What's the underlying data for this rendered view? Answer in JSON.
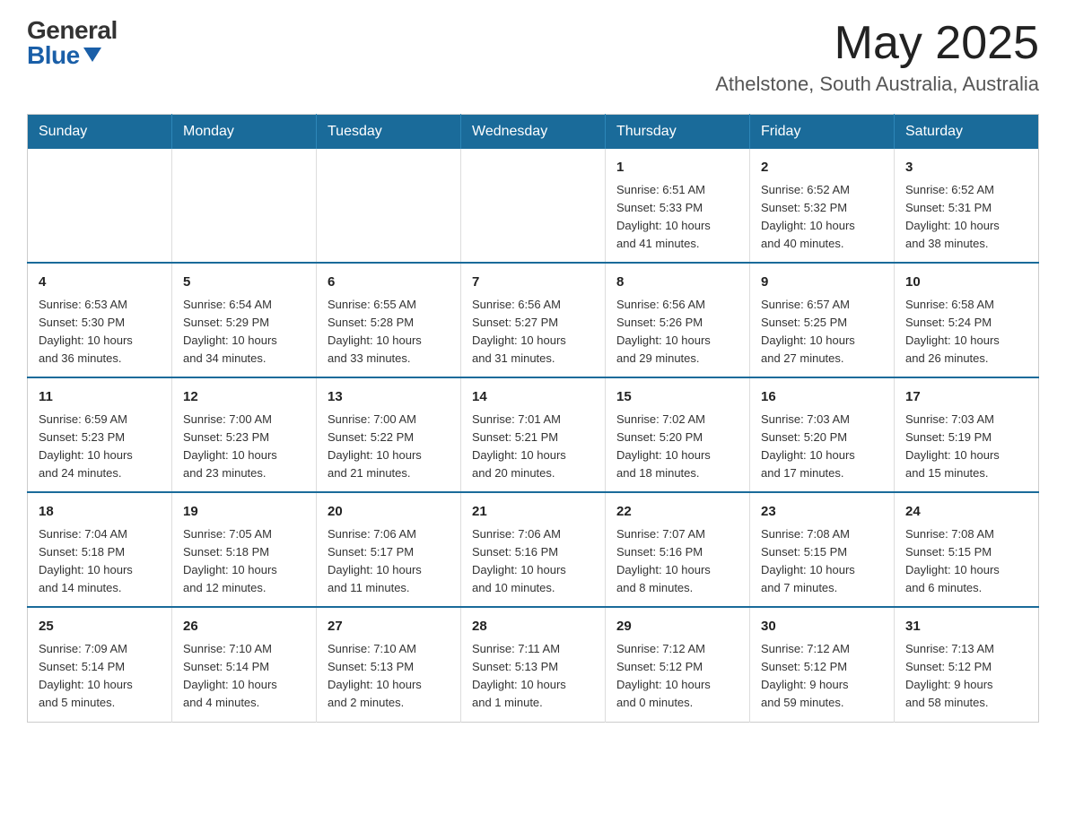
{
  "header": {
    "logo_general": "General",
    "logo_blue": "Blue",
    "month_title": "May 2025",
    "location": "Athelstone, South Australia, Australia"
  },
  "calendar": {
    "days_of_week": [
      "Sunday",
      "Monday",
      "Tuesday",
      "Wednesday",
      "Thursday",
      "Friday",
      "Saturday"
    ],
    "weeks": [
      [
        {
          "day": "",
          "info": ""
        },
        {
          "day": "",
          "info": ""
        },
        {
          "day": "",
          "info": ""
        },
        {
          "day": "",
          "info": ""
        },
        {
          "day": "1",
          "info": "Sunrise: 6:51 AM\nSunset: 5:33 PM\nDaylight: 10 hours\nand 41 minutes."
        },
        {
          "day": "2",
          "info": "Sunrise: 6:52 AM\nSunset: 5:32 PM\nDaylight: 10 hours\nand 40 minutes."
        },
        {
          "day": "3",
          "info": "Sunrise: 6:52 AM\nSunset: 5:31 PM\nDaylight: 10 hours\nand 38 minutes."
        }
      ],
      [
        {
          "day": "4",
          "info": "Sunrise: 6:53 AM\nSunset: 5:30 PM\nDaylight: 10 hours\nand 36 minutes."
        },
        {
          "day": "5",
          "info": "Sunrise: 6:54 AM\nSunset: 5:29 PM\nDaylight: 10 hours\nand 34 minutes."
        },
        {
          "day": "6",
          "info": "Sunrise: 6:55 AM\nSunset: 5:28 PM\nDaylight: 10 hours\nand 33 minutes."
        },
        {
          "day": "7",
          "info": "Sunrise: 6:56 AM\nSunset: 5:27 PM\nDaylight: 10 hours\nand 31 minutes."
        },
        {
          "day": "8",
          "info": "Sunrise: 6:56 AM\nSunset: 5:26 PM\nDaylight: 10 hours\nand 29 minutes."
        },
        {
          "day": "9",
          "info": "Sunrise: 6:57 AM\nSunset: 5:25 PM\nDaylight: 10 hours\nand 27 minutes."
        },
        {
          "day": "10",
          "info": "Sunrise: 6:58 AM\nSunset: 5:24 PM\nDaylight: 10 hours\nand 26 minutes."
        }
      ],
      [
        {
          "day": "11",
          "info": "Sunrise: 6:59 AM\nSunset: 5:23 PM\nDaylight: 10 hours\nand 24 minutes."
        },
        {
          "day": "12",
          "info": "Sunrise: 7:00 AM\nSunset: 5:23 PM\nDaylight: 10 hours\nand 23 minutes."
        },
        {
          "day": "13",
          "info": "Sunrise: 7:00 AM\nSunset: 5:22 PM\nDaylight: 10 hours\nand 21 minutes."
        },
        {
          "day": "14",
          "info": "Sunrise: 7:01 AM\nSunset: 5:21 PM\nDaylight: 10 hours\nand 20 minutes."
        },
        {
          "day": "15",
          "info": "Sunrise: 7:02 AM\nSunset: 5:20 PM\nDaylight: 10 hours\nand 18 minutes."
        },
        {
          "day": "16",
          "info": "Sunrise: 7:03 AM\nSunset: 5:20 PM\nDaylight: 10 hours\nand 17 minutes."
        },
        {
          "day": "17",
          "info": "Sunrise: 7:03 AM\nSunset: 5:19 PM\nDaylight: 10 hours\nand 15 minutes."
        }
      ],
      [
        {
          "day": "18",
          "info": "Sunrise: 7:04 AM\nSunset: 5:18 PM\nDaylight: 10 hours\nand 14 minutes."
        },
        {
          "day": "19",
          "info": "Sunrise: 7:05 AM\nSunset: 5:18 PM\nDaylight: 10 hours\nand 12 minutes."
        },
        {
          "day": "20",
          "info": "Sunrise: 7:06 AM\nSunset: 5:17 PM\nDaylight: 10 hours\nand 11 minutes."
        },
        {
          "day": "21",
          "info": "Sunrise: 7:06 AM\nSunset: 5:16 PM\nDaylight: 10 hours\nand 10 minutes."
        },
        {
          "day": "22",
          "info": "Sunrise: 7:07 AM\nSunset: 5:16 PM\nDaylight: 10 hours\nand 8 minutes."
        },
        {
          "day": "23",
          "info": "Sunrise: 7:08 AM\nSunset: 5:15 PM\nDaylight: 10 hours\nand 7 minutes."
        },
        {
          "day": "24",
          "info": "Sunrise: 7:08 AM\nSunset: 5:15 PM\nDaylight: 10 hours\nand 6 minutes."
        }
      ],
      [
        {
          "day": "25",
          "info": "Sunrise: 7:09 AM\nSunset: 5:14 PM\nDaylight: 10 hours\nand 5 minutes."
        },
        {
          "day": "26",
          "info": "Sunrise: 7:10 AM\nSunset: 5:14 PM\nDaylight: 10 hours\nand 4 minutes."
        },
        {
          "day": "27",
          "info": "Sunrise: 7:10 AM\nSunset: 5:13 PM\nDaylight: 10 hours\nand 2 minutes."
        },
        {
          "day": "28",
          "info": "Sunrise: 7:11 AM\nSunset: 5:13 PM\nDaylight: 10 hours\nand 1 minute."
        },
        {
          "day": "29",
          "info": "Sunrise: 7:12 AM\nSunset: 5:12 PM\nDaylight: 10 hours\nand 0 minutes."
        },
        {
          "day": "30",
          "info": "Sunrise: 7:12 AM\nSunset: 5:12 PM\nDaylight: 9 hours\nand 59 minutes."
        },
        {
          "day": "31",
          "info": "Sunrise: 7:13 AM\nSunset: 5:12 PM\nDaylight: 9 hours\nand 58 minutes."
        }
      ]
    ]
  }
}
